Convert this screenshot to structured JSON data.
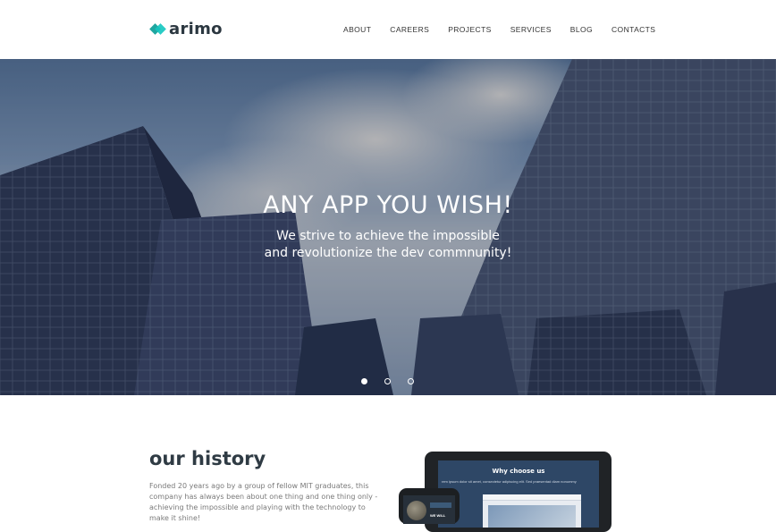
{
  "header": {
    "logo_text": "arimo",
    "nav": [
      {
        "label": "ABOUT"
      },
      {
        "label": "CAREERS"
      },
      {
        "label": "PROJECTS"
      },
      {
        "label": "SERVICES"
      },
      {
        "label": "BLOG"
      },
      {
        "label": "CONTACTS"
      }
    ]
  },
  "hero": {
    "title": "ANY APP YOU WISH!",
    "subtitle_line1": "We strive to achieve the impossible",
    "subtitle_line2": "and revolutionize the dev commnunity!",
    "slides": [
      {
        "active": true
      },
      {
        "active": false
      },
      {
        "active": false
      }
    ]
  },
  "history": {
    "title": "our history",
    "text": "Fonded 20 years ago by a group of fellow MIT graduates, this company has always been about one thing and one thing only - achieving the impossible and playing with the technology to make it shine!"
  },
  "devices": {
    "tablet_title": "Why choose us",
    "tablet_line": "rem ipsum dolor sit amet, consectetur adipiscing elit. Sed praesentad diam nonummy",
    "tablet_label": "WE WILL"
  },
  "colors": {
    "accent": "#1fa6a0",
    "header_bg": "#ffffff",
    "text_dark": "#2f3b44"
  }
}
